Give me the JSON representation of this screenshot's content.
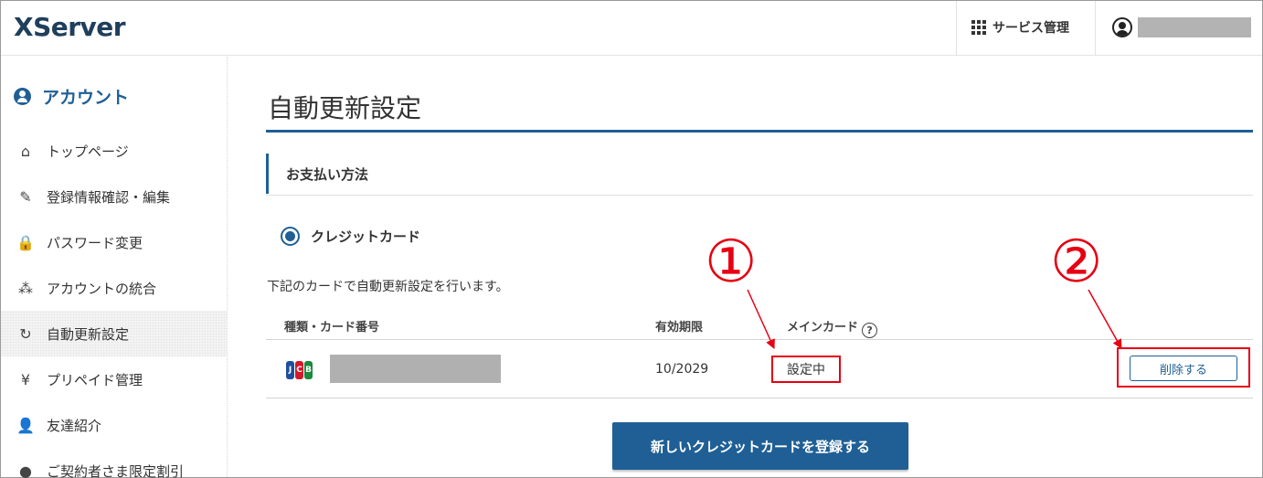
{
  "header": {
    "logo": "XServer",
    "services_label": "サービス管理",
    "user_name_redacted": true
  },
  "sidebar": {
    "title": "アカウント",
    "items": [
      {
        "label": "トップページ",
        "icon": "home-icon",
        "glyph": "⌂",
        "active": false
      },
      {
        "label": "登録情報確認・編集",
        "icon": "edit-icon",
        "glyph": "✎",
        "active": false
      },
      {
        "label": "パスワード変更",
        "icon": "lock-icon",
        "glyph": "🔒",
        "active": false
      },
      {
        "label": "アカウントの統合",
        "icon": "merge-icon",
        "glyph": "⁂",
        "active": false
      },
      {
        "label": "自動更新設定",
        "icon": "refresh-icon",
        "glyph": "↻",
        "active": true
      },
      {
        "label": "プリペイド管理",
        "icon": "yen-icon",
        "glyph": "¥",
        "active": false
      },
      {
        "label": "友達紹介",
        "icon": "friend-icon",
        "glyph": "👤",
        "active": false
      },
      {
        "label": "ご契約者さま限定割引",
        "icon": "discount-icon",
        "glyph": "●",
        "active": false
      }
    ]
  },
  "main": {
    "page_title": "自動更新設定",
    "section_title": "お支払い方法",
    "payment_option": "クレジットカード",
    "description": "下記のカードで自動更新設定を行います。",
    "table": {
      "headers": {
        "card": "種類・カード番号",
        "expiry": "有効期限",
        "main_card": "メインカード"
      },
      "rows": [
        {
          "card_brand": "JCB",
          "card_number_redacted": true,
          "expiry": "10/2029",
          "main_status": "設定中",
          "delete_label": "削除する"
        }
      ]
    },
    "add_card_label": "新しいクレジットカードを登録する"
  },
  "annotations": {
    "marker1": "①",
    "marker2": "②"
  },
  "colors": {
    "brand": "#1f5f95",
    "highlight": "#e60012",
    "redaction": "#b0b0b0"
  }
}
